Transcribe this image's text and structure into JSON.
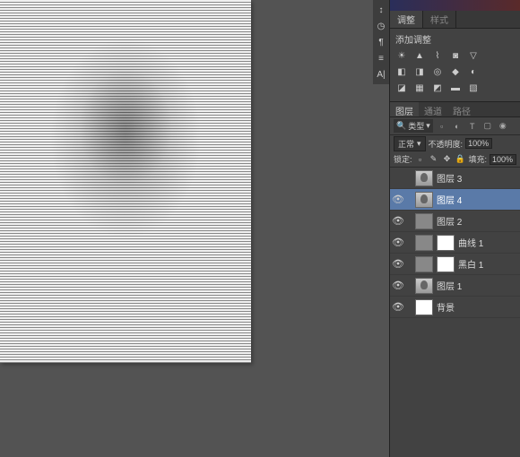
{
  "panels": {
    "adjust_tab": "调整",
    "styles_tab": "样式",
    "add_adjust": "添加调整"
  },
  "layers_panel": {
    "tabs": [
      "图层",
      "通道",
      "路径"
    ],
    "filter_label": "类型",
    "blend_mode": "正常",
    "opacity_label": "不透明度:",
    "opacity_value": "100%",
    "lock_label": "锁定:",
    "fill_label": "填充:",
    "fill_value": "100%"
  },
  "layers": [
    {
      "name": "图层 3",
      "visible": false,
      "selected": false,
      "type": "raster"
    },
    {
      "name": "图层 4",
      "visible": true,
      "selected": true,
      "type": "raster"
    },
    {
      "name": "图层 2",
      "visible": true,
      "selected": false,
      "type": "raster-gray"
    },
    {
      "name": "曲线 1",
      "visible": true,
      "selected": false,
      "type": "adjustment"
    },
    {
      "name": "黑白 1",
      "visible": true,
      "selected": false,
      "type": "adjustment"
    },
    {
      "name": "图层 1",
      "visible": true,
      "selected": false,
      "type": "raster"
    },
    {
      "name": "背景",
      "visible": true,
      "selected": false,
      "type": "bg"
    }
  ]
}
